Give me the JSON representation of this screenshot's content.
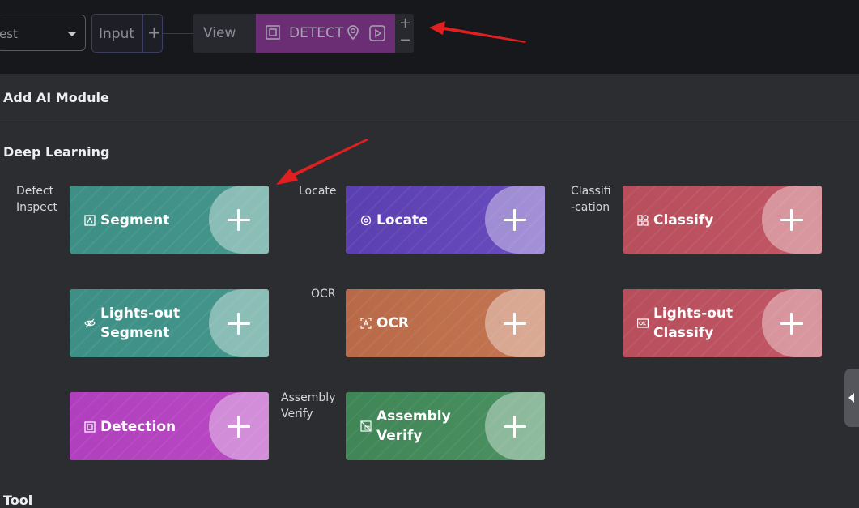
{
  "toolbar": {
    "select_value": "est",
    "input_label": "Input",
    "input_plus": "+",
    "view_label": "View",
    "detect_label": "DETECT",
    "zoom_in": "+",
    "zoom_out": "−"
  },
  "panel": {
    "title": "Add AI Module",
    "section_deep_learning": "Deep Learning",
    "section_tool": "Tool"
  },
  "categories": {
    "defect_inspect": [
      "Defect",
      "Inspect"
    ],
    "locate": "Locate",
    "classification": [
      "Classifi",
      "-cation"
    ],
    "ocr": "OCR",
    "assembly_verify": [
      "Assembly",
      "Verify"
    ]
  },
  "modules": {
    "segment": {
      "label": "Segment",
      "icon": "segment-icon",
      "color": "#3d8f86"
    },
    "locate": {
      "label": "Locate",
      "icon": "locate-icon",
      "color": "#5a3fb0"
    },
    "classify": {
      "label": "Classify",
      "icon": "classify-icon",
      "color": "#b74e5c"
    },
    "lights_out_segment": {
      "label_line1": "Lights-out",
      "label_line2": "Segment",
      "icon": "eye-off-icon",
      "color": "#3d8f86"
    },
    "ocr": {
      "label": "OCR",
      "icon": "ocr-icon",
      "color": "#b86a48"
    },
    "lights_out_classify": {
      "label_line1": "Lights-out",
      "label_line2": "Classify",
      "icon": "ok-badge-icon",
      "color": "#b74e5c"
    },
    "detection": {
      "label": "Detection",
      "icon": "detection-icon",
      "color": "#b03fbd"
    },
    "assembly_verify": {
      "label_line1": "Assembly",
      "label_line2": "Verify",
      "icon": "assembly-icon",
      "color": "#3f8556"
    }
  }
}
